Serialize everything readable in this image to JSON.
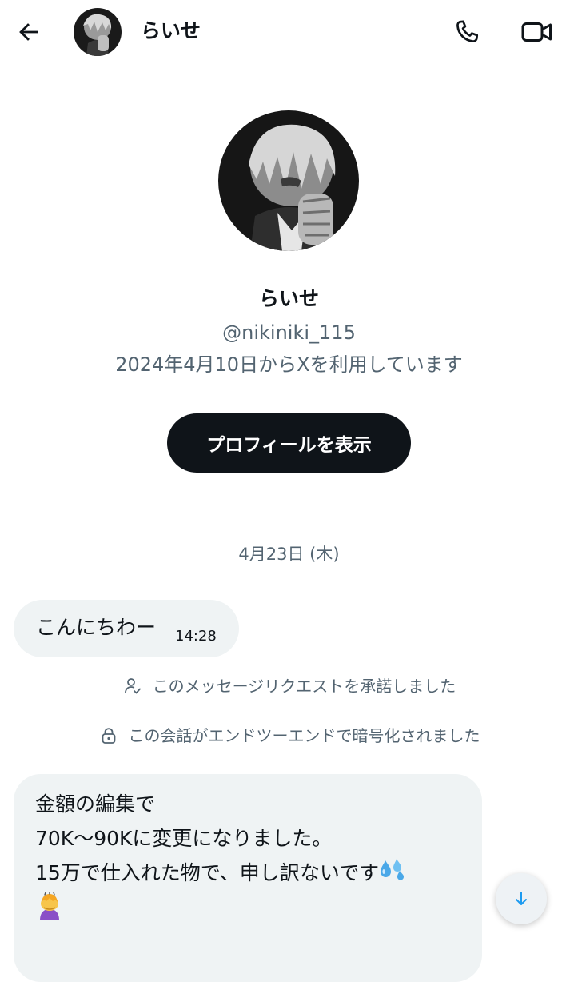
{
  "header": {
    "name": "らいせ",
    "back_icon": "arrow-left-icon",
    "call_icon": "phone-icon",
    "video_icon": "video-camera-icon"
  },
  "profile": {
    "name": "らいせ",
    "handle": "@nikiniki_115",
    "joined": "2024年4月10日からXを利用しています",
    "view_profile_label": "プロフィールを表示"
  },
  "conversation": {
    "date_separator": "4月23日 (木)",
    "messages": [
      {
        "text": "こんにちわー",
        "time": "14:28"
      }
    ],
    "system_messages": {
      "accepted": "このメッセージリクエストを承諾しました",
      "accepted_icon": "person-check-icon",
      "encrypted": "この会話がエンドツーエンドで暗号化されました",
      "encrypted_icon": "lock-icon"
    },
    "last_message": {
      "lines": [
        "金額の編集で",
        "70K～90Kに変更になりました。",
        "15万で仕入れた物で、申し訳ないです"
      ],
      "emojis": [
        "sweat-droplets-emoji",
        "woman-bowing-emoji"
      ]
    }
  },
  "scroll_down_icon": "arrow-down-icon",
  "colors": {
    "text_primary": "#0f1419",
    "text_secondary": "#536471",
    "bubble_bg": "#eff3f4",
    "button_bg": "#0f1419",
    "accent_blue": "#1d9bf0"
  }
}
